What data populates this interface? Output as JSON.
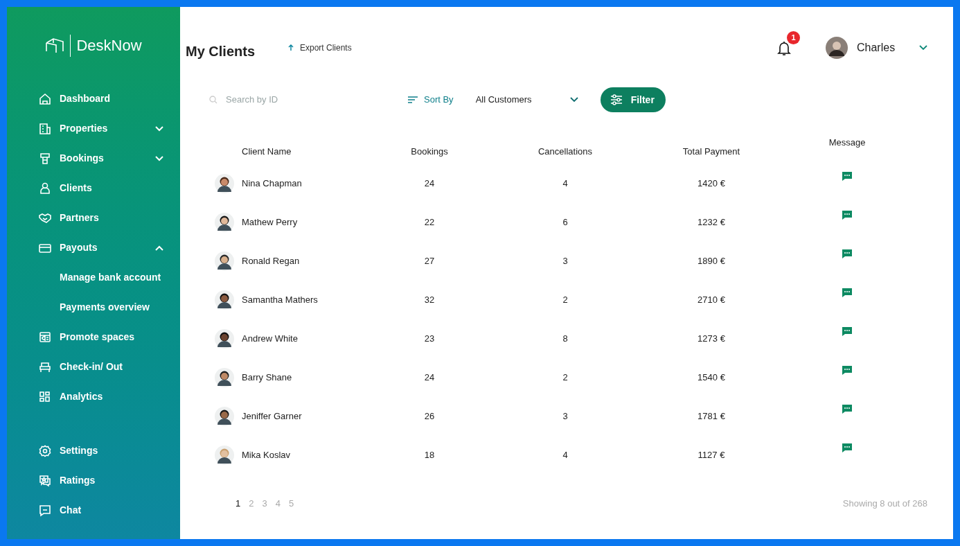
{
  "brand": {
    "name": "DeskNow"
  },
  "sidebar": {
    "items": [
      {
        "kind": "link",
        "label": "Dashboard"
      },
      {
        "kind": "group",
        "label": "Properties",
        "expanded": false
      },
      {
        "kind": "group",
        "label": "Bookings",
        "expanded": false
      },
      {
        "kind": "link",
        "label": "Clients"
      },
      {
        "kind": "link",
        "label": "Partners"
      },
      {
        "kind": "group",
        "label": "Payouts",
        "expanded": true,
        "children": [
          {
            "label": "Manage bank account"
          },
          {
            "label": "Payments overview"
          }
        ]
      },
      {
        "kind": "link",
        "label": "Promote spaces"
      },
      {
        "kind": "link",
        "label": "Check-in/ Out"
      },
      {
        "kind": "link",
        "label": "Analytics"
      }
    ],
    "bottom_items": [
      {
        "label": "Settings"
      },
      {
        "label": "Ratings"
      },
      {
        "label": "Chat"
      }
    ]
  },
  "header": {
    "title": "My Clients",
    "export": "Export Clients",
    "notifications": "1",
    "user": "Charles"
  },
  "toolbar": {
    "search_placeholder": "Search by ID",
    "sort": "Sort By",
    "customer_filter": "All Customers",
    "filter_button": "Filter"
  },
  "table": {
    "columns": [
      "Client Name",
      "Bookings",
      "Cancellations",
      "Total Payment",
      "Message"
    ],
    "rows": [
      {
        "name": "Nina Chapman",
        "bookings": "24",
        "cancellations": "4",
        "payment": "1420 €"
      },
      {
        "name": "Mathew Perry",
        "bookings": "22",
        "cancellations": "6",
        "payment": "1232 €"
      },
      {
        "name": "Ronald Regan",
        "bookings": "27",
        "cancellations": "3",
        "payment": "1890 €"
      },
      {
        "name": "Samantha Mathers",
        "bookings": "32",
        "cancellations": "2",
        "payment": "2710 €"
      },
      {
        "name": "Andrew White",
        "bookings": "23",
        "cancellations": "8",
        "payment": "1273 €"
      },
      {
        "name": "Barry Shane",
        "bookings": "24",
        "cancellations": "2",
        "payment": "1540 €"
      },
      {
        "name": "Jeniffer Garner",
        "bookings": "26",
        "cancellations": "3",
        "payment": "1781 €"
      },
      {
        "name": "Mika Koslav",
        "bookings": "18",
        "cancellations": "4",
        "payment": "1127 €"
      }
    ]
  },
  "pagination": {
    "pages": [
      {
        "label": "1",
        "selected": true
      },
      {
        "label": "2",
        "selected": false
      },
      {
        "label": "3",
        "selected": false
      },
      {
        "label": "4",
        "selected": false
      },
      {
        "label": "5",
        "selected": false
      }
    ],
    "summary": "Showing 8 out of 268"
  }
}
